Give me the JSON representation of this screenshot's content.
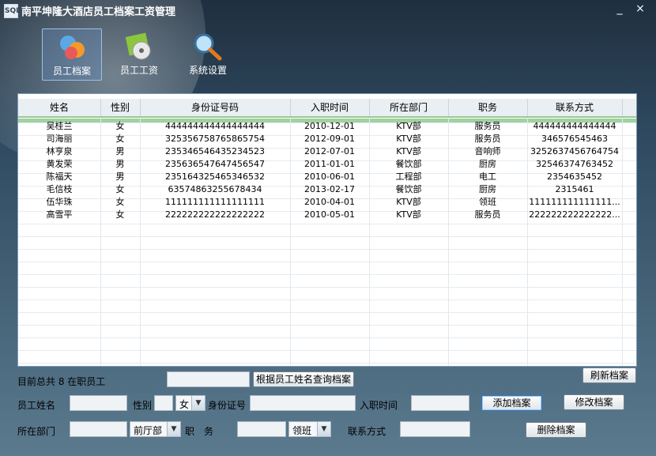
{
  "window": {
    "app_icon_text": "SQL",
    "title": "南平坤隆大酒店员工档案工资管理",
    "minimize": "_",
    "close": "×"
  },
  "toolbar": [
    {
      "label": "员工档案",
      "icon": "users-icon",
      "active": true
    },
    {
      "label": "员工工资",
      "icon": "salary-disc-icon",
      "active": false
    },
    {
      "label": "系统设置",
      "icon": "magnifier-icon",
      "active": false
    }
  ],
  "table": {
    "columns": [
      "姓名",
      "性别",
      "身份证号码",
      "入职时间",
      "所在部门",
      "职务",
      "联系方式"
    ],
    "rows": [
      [
        "吴桂兰",
        "女",
        "444444444444444444",
        "2010-12-01",
        "KTV部",
        "服务员",
        "444444444444444"
      ],
      [
        "司海丽",
        "女",
        "325356758765865754",
        "2012-09-01",
        "KTV部",
        "服务员",
        "346576545463"
      ],
      [
        "林亨泉",
        "男",
        "235346546435234523",
        "2012-07-01",
        "KTV部",
        "音响师",
        "3252637456764754"
      ],
      [
        "黄发荣",
        "男",
        "235636547647456547",
        "2011-01-01",
        "餐饮部",
        "厨房",
        "32546374763452"
      ],
      [
        "陈福天",
        "男",
        "235164325465346532",
        "2010-06-01",
        "工程部",
        "电工",
        "2354635452"
      ],
      [
        "毛信枝",
        "女",
        "63574863255678434",
        "2013-02-17",
        "餐饮部",
        "厨房",
        "2315461"
      ],
      [
        "伍华珠",
        "女",
        "111111111111111111",
        "2010-04-01",
        "KTV部",
        "领班",
        "111111111111111..."
      ],
      [
        "高雪平",
        "女",
        "222222222222222222",
        "2010-05-01",
        "KTV部",
        "服务员",
        "222222222222222..."
      ]
    ]
  },
  "summary": {
    "text": "目前总共  8  在职员工"
  },
  "search": {
    "value": "",
    "button": "根据员工姓名查询档案"
  },
  "refresh_button": "刷新档案",
  "form": {
    "name_label": "员工姓名",
    "name_value": "",
    "gender_label": "性别",
    "gender_value": "女",
    "id_label": "身份证号",
    "id_value": "",
    "hire_label": "入职时间",
    "hire_value": "",
    "dept_label": "所在部门",
    "dept_value": "",
    "dept_select": "前厅部",
    "position_label": "职　务",
    "position_value": "",
    "position_select": "领班",
    "contact_label": "联系方式",
    "contact_value": ""
  },
  "buttons": {
    "add": "添加档案",
    "edit": "修改档案",
    "delete": "删除档案"
  }
}
